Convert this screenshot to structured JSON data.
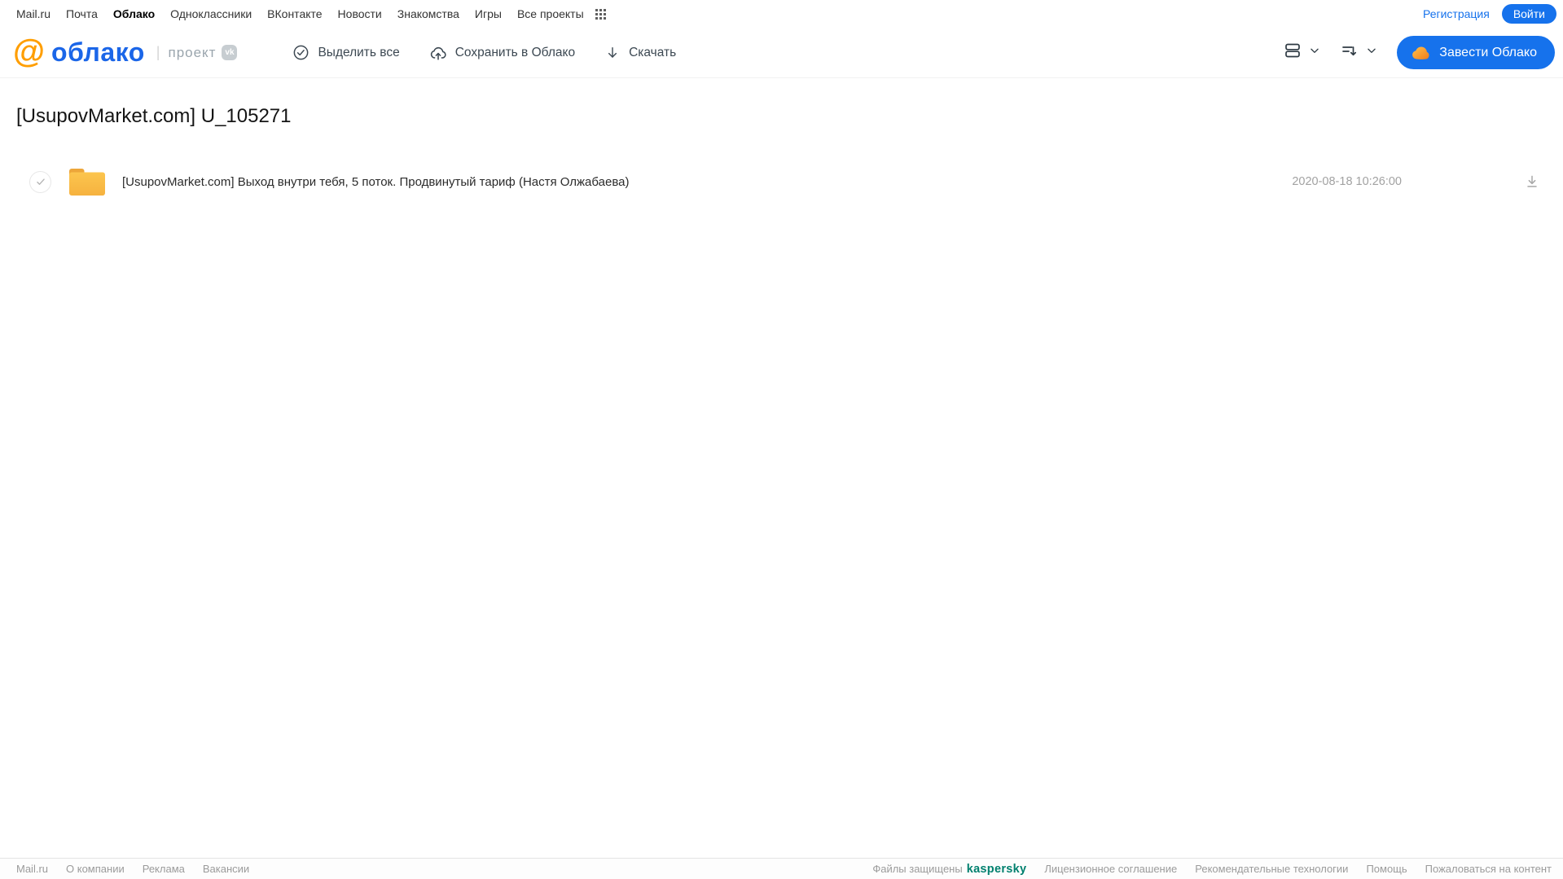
{
  "topnav": {
    "items": [
      "Mail.ru",
      "Почта",
      "Облако",
      "Одноклассники",
      "ВКонтакте",
      "Новости",
      "Знакомства",
      "Игры",
      "Все проекты"
    ],
    "active_item": "Облако",
    "registration_label": "Регистрация",
    "login_label": "Войти"
  },
  "header": {
    "logo_at": "@",
    "logo_word": "облако",
    "logo_divider": "|",
    "project_label": "проект",
    "vk_badge": "vk",
    "toolbar": [
      {
        "label": "Выделить все"
      },
      {
        "label": "Сохранить в Облако"
      },
      {
        "label": "Скачать"
      }
    ],
    "create_cloud_label": "Завести Облако"
  },
  "main": {
    "title": "[UsupovMarket.com] U_105271",
    "files": [
      {
        "type": "folder",
        "name": "[UsupovMarket.com] Выход внутри тебя, 5 поток. Продвинутый тариф (Настя Олжабаева)",
        "date": "2020-08-18 10:26:00"
      }
    ]
  },
  "footer": {
    "left_links": [
      "Mail.ru",
      "О компании",
      "Реклама",
      "Вакансии"
    ],
    "protected_prefix": "Файлы защищены",
    "kaspersky_logo": "kaspersky",
    "right_links": [
      "Лицензионное соглашение",
      "Рекомендательные технологии",
      "Помощь",
      "Пожаловаться на контент"
    ]
  },
  "colors": {
    "accent_blue": "#1672ec",
    "logo_orange": "#ff9e00",
    "folder_yellow": "#fbbd45",
    "kaspersky_green": "#00806e"
  }
}
